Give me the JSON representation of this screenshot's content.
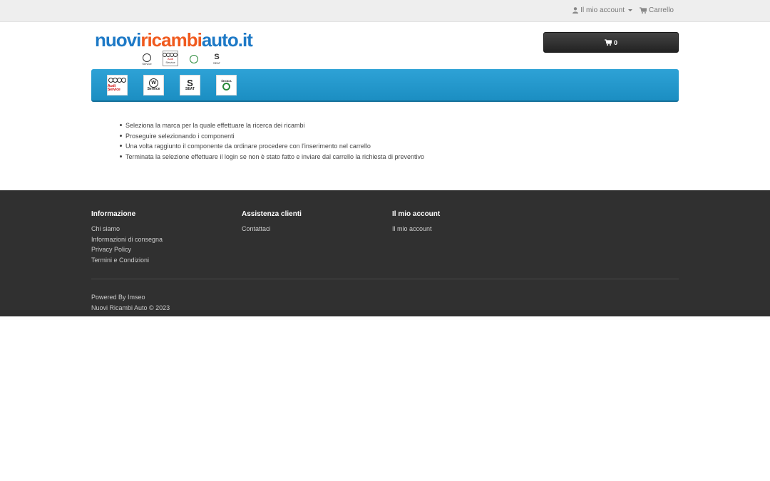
{
  "topbar": {
    "account_label": "Il mio account",
    "cart_label": "Carrello",
    "user_icon": "user-icon",
    "cart_icon": "shopping-cart-icon"
  },
  "header": {
    "logo_part1": "nuovi",
    "logo_part2": "ricambi",
    "logo_part3": "auto.it",
    "cart_count": "0",
    "brand_color": "#1d79c6",
    "accent_color": "#f05a1e"
  },
  "menu": {
    "brands": [
      {
        "name": "Audi",
        "label": "Audi Service"
      },
      {
        "name": "Volkswagen",
        "label": "Service"
      },
      {
        "name": "SEAT",
        "label": "SEAT"
      },
      {
        "name": "Skoda",
        "label": "ŠKODA"
      }
    ],
    "bar_color": "#2ea2d6"
  },
  "instructions": [
    "Seleziona la marca per la quale effettuare la ricerca dei ricambi",
    "Proseguire selezionando i componenti",
    "Una volta raggiunto il componente da ordinare procedere con l'inserimento nel carrello",
    "Terminata la selezione effettuare il login se non è stato fatto e inviare dal carrello la richiesta di preventivo"
  ],
  "footer": {
    "columns": [
      {
        "title": "Informazione",
        "links": [
          "Chi siamo",
          "Informazioni di consegna",
          "Privacy Policy",
          "Termini e Condizioni"
        ]
      },
      {
        "title": "Assistenza clienti",
        "links": [
          "Contattaci"
        ]
      },
      {
        "title": "Il mio account",
        "links": [
          "Il mio account"
        ]
      }
    ],
    "powered_prefix": "Powered By",
    "powered_link": "Imseo",
    "copyright": "Nuovi Ricambi Auto © 2023"
  }
}
